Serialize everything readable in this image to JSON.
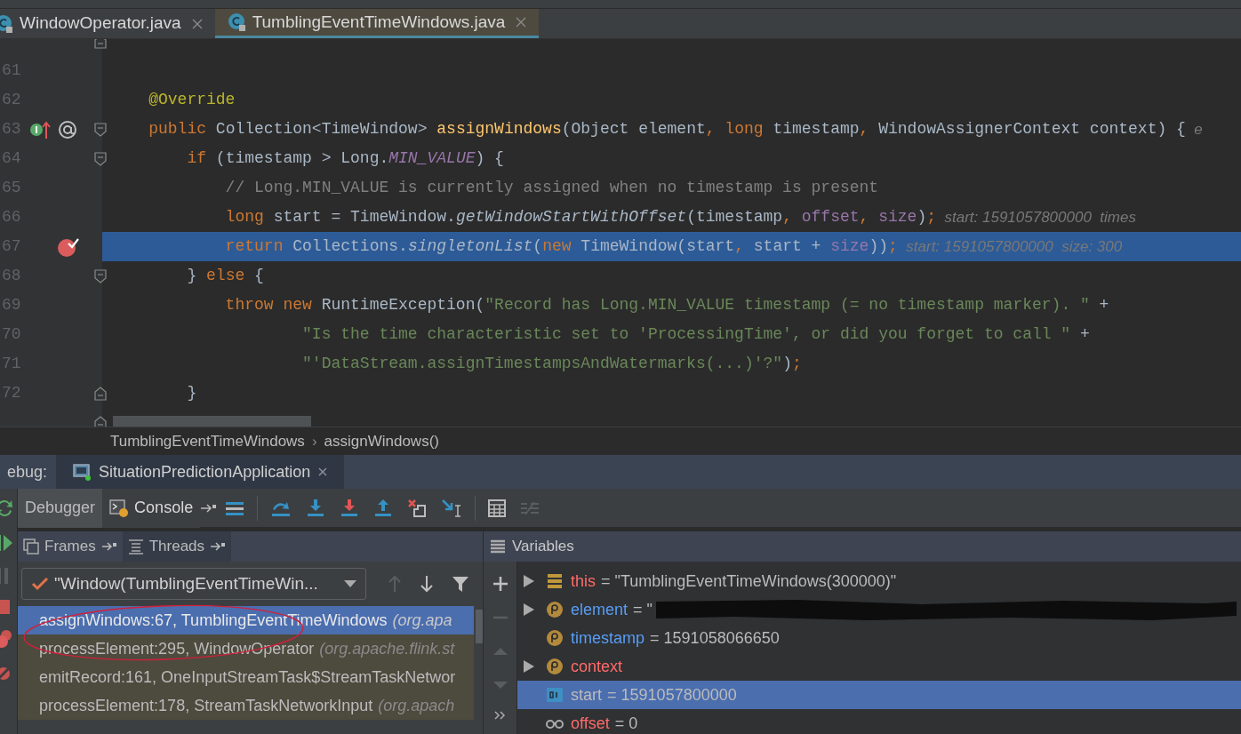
{
  "tabs": [
    {
      "label": "WindowOperator.java",
      "selected": false
    },
    {
      "label": "TumblingEventTimeWindows.java",
      "selected": true
    }
  ],
  "editor": {
    "lines": [
      {
        "highlighted": false,
        "breakpoint": false,
        "overridden": false,
        "fold_start": false,
        "fold_end": true
      },
      {
        "number": "61",
        "highlighted": false,
        "breakpoint": false,
        "overridden": false,
        "fold_start": false,
        "fold_end": false
      },
      {
        "number": "62",
        "highlighted": false,
        "breakpoint": false,
        "overridden": false,
        "fold_start": false,
        "fold_end": false,
        "tokens": [
          {
            "kind": "annotation",
            "text": "    @Override"
          }
        ]
      },
      {
        "number": "63",
        "highlighted": false,
        "breakpoint": false,
        "overridden": true,
        "fold_start": true,
        "fold_end": false,
        "tokens": [
          {
            "kind": "keyword",
            "text": "    public"
          },
          {
            "kind": "plain",
            "text": " Collection<TimeWindow> "
          },
          {
            "kind": "method",
            "text": "assignWindows"
          },
          {
            "kind": "plain",
            "text": "(Object element"
          },
          {
            "kind": "punct",
            "text": ", "
          },
          {
            "kind": "keyword",
            "text": "long"
          },
          {
            "kind": "plain",
            "text": " timestamp"
          },
          {
            "kind": "punct",
            "text": ", "
          },
          {
            "kind": "plain",
            "text": "WindowAssignerContext context) {"
          },
          {
            "kind": "hint",
            "text": "  e"
          }
        ]
      },
      {
        "number": "64",
        "highlighted": false,
        "breakpoint": false,
        "overridden": false,
        "fold_start": true,
        "fold_end": false,
        "tokens": [
          {
            "kind": "keyword",
            "text": "        if"
          },
          {
            "kind": "plain",
            "text": " (timestamp > Long."
          },
          {
            "kind": "static",
            "text": "MIN_VALUE"
          },
          {
            "kind": "plain",
            "text": ") {"
          }
        ]
      },
      {
        "number": "65",
        "highlighted": false,
        "breakpoint": false,
        "overridden": false,
        "fold_start": false,
        "fold_end": false,
        "tokens": [
          {
            "kind": "comment",
            "text": "            // Long.MIN_VALUE is currently assigned when no timestamp is present"
          }
        ]
      },
      {
        "number": "66",
        "highlighted": false,
        "breakpoint": false,
        "overridden": false,
        "fold_start": false,
        "fold_end": false,
        "tokens": [
          {
            "kind": "keyword",
            "text": "            long"
          },
          {
            "kind": "plain",
            "text": " start = TimeWindow."
          },
          {
            "kind": "italic",
            "text": "getWindowStartWithOffset"
          },
          {
            "kind": "plain",
            "text": "(timestamp"
          },
          {
            "kind": "punct",
            "text": ", "
          },
          {
            "kind": "field",
            "text": "offset"
          },
          {
            "kind": "punct",
            "text": ", "
          },
          {
            "kind": "field",
            "text": "size"
          },
          {
            "kind": "plain",
            "text": ")"
          },
          {
            "kind": "punct",
            "text": ";"
          },
          {
            "kind": "hint",
            "text": "  start: 1591057800000  times"
          }
        ]
      },
      {
        "number": "67",
        "highlighted": true,
        "breakpoint": true,
        "overridden": false,
        "fold_start": false,
        "fold_end": false,
        "tokens": [
          {
            "kind": "keyword",
            "text": "            return"
          },
          {
            "kind": "plain",
            "text": " Collections."
          },
          {
            "kind": "italic",
            "text": "singletonList"
          },
          {
            "kind": "plain",
            "text": "("
          },
          {
            "kind": "keyword",
            "text": "new"
          },
          {
            "kind": "plain",
            "text": " TimeWindow(start"
          },
          {
            "kind": "punct",
            "text": ", "
          },
          {
            "kind": "plain",
            "text": "start + "
          },
          {
            "kind": "field",
            "text": "size"
          },
          {
            "kind": "plain",
            "text": "))"
          },
          {
            "kind": "punct",
            "text": ";"
          },
          {
            "kind": "hint",
            "text": "  start: 1591057800000  size: 300"
          }
        ]
      },
      {
        "number": "68",
        "highlighted": false,
        "breakpoint": false,
        "overridden": false,
        "fold_start": true,
        "fold_end": false,
        "tokens": [
          {
            "kind": "plain",
            "text": "        } "
          },
          {
            "kind": "keyword",
            "text": "else"
          },
          {
            "kind": "plain",
            "text": " {"
          }
        ]
      },
      {
        "number": "69",
        "highlighted": false,
        "breakpoint": false,
        "overridden": false,
        "fold_start": false,
        "fold_end": false,
        "tokens": [
          {
            "kind": "keyword",
            "text": "            throw new"
          },
          {
            "kind": "plain",
            "text": " RuntimeException("
          },
          {
            "kind": "string",
            "text": "\"Record has Long.MIN_VALUE timestamp (= no timestamp marker). \""
          },
          {
            "kind": "plain",
            "text": " +"
          }
        ]
      },
      {
        "number": "70",
        "highlighted": false,
        "breakpoint": false,
        "overridden": false,
        "fold_start": false,
        "fold_end": false,
        "tokens": [
          {
            "kind": "string",
            "text": "                    \"Is the time characteristic set to 'ProcessingTime', or did you forget to call \""
          },
          {
            "kind": "plain",
            "text": " +"
          }
        ]
      },
      {
        "number": "71",
        "highlighted": false,
        "breakpoint": false,
        "overridden": false,
        "fold_start": false,
        "fold_end": false,
        "tokens": [
          {
            "kind": "string",
            "text": "                    \"'DataStream.assignTimestampsAndWatermarks(...)'?\""
          },
          {
            "kind": "plain",
            "text": ")"
          },
          {
            "kind": "punct",
            "text": ";"
          }
        ]
      },
      {
        "number": "72",
        "highlighted": false,
        "breakpoint": false,
        "overridden": false,
        "fold_start": false,
        "fold_end": true,
        "tokens": [
          {
            "kind": "plain",
            "text": "        }"
          }
        ]
      },
      {
        "highlighted": false,
        "breakpoint": false,
        "overridden": false,
        "fold_start": false,
        "fold_end": true
      }
    ]
  },
  "breadcrumb": {
    "class": "TumblingEventTimeWindows",
    "separator": "›",
    "method": "assignWindows()"
  },
  "debug": {
    "label": "ebug:",
    "session": "SituationPredictionApplication",
    "tabs": [
      {
        "label": "Debugger",
        "selected": true
      },
      {
        "label": "Console",
        "selected": false
      }
    ],
    "frames_tabs": [
      "Frames",
      "Threads"
    ],
    "thread": "\"Window(TumblingEventTimeWin...",
    "frames": [
      {
        "method": "assignWindows:67, TumblingEventTimeWindows",
        "package": "(org.apa",
        "selected": true
      },
      {
        "method": "processElement:295, WindowOperator",
        "package": "(org.apache.flink.st",
        "selected": false
      },
      {
        "method": "emitRecord:161, OneInputStreamTask$StreamTaskNetwor",
        "selected": false
      },
      {
        "method": "processElement:178, StreamTaskNetworkInput",
        "package": "(org.apach",
        "selected": false
      }
    ],
    "variables_title": "Variables",
    "variables": [
      {
        "kind": "field",
        "name": "this",
        "value": "= \"TumblingEventTimeWindows(300000)\"",
        "expandable": true,
        "selected": false,
        "color": "#ff6b68"
      },
      {
        "kind": "param",
        "name": "element",
        "value": "= \"",
        "redacted": true,
        "expandable": true,
        "selected": false,
        "color": "#589df6"
      },
      {
        "kind": "param",
        "name": "timestamp",
        "value": "= 1591058066650",
        "expandable": false,
        "selected": false,
        "color": "#589df6"
      },
      {
        "kind": "param",
        "name": "context",
        "expandable": true,
        "selected": false,
        "color": "#ff6b68"
      },
      {
        "kind": "local",
        "name": "start",
        "value": "= 1591057800000",
        "expandable": false,
        "selected": true,
        "color": "#bbbbbb"
      },
      {
        "kind": "watch",
        "name": "offset",
        "value": "= 0",
        "expandable": false,
        "selected": false,
        "color": "#ff6b68"
      }
    ]
  }
}
